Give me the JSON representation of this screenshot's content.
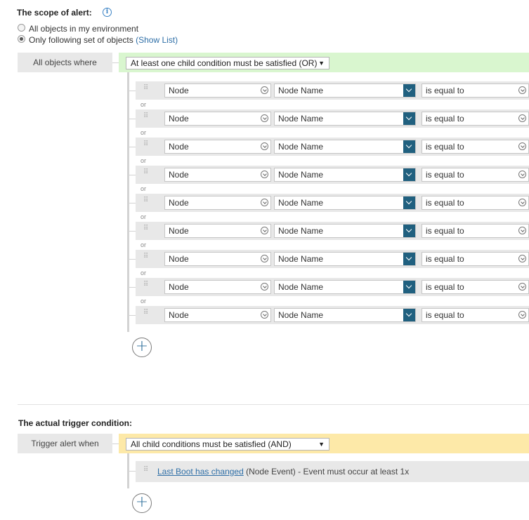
{
  "scope": {
    "title": "The scope of alert:",
    "info_icon": "info-icon",
    "option_all": "All objects in my environment",
    "option_following": "Only following set of objects",
    "show_list": "(Show List)",
    "selected": "following"
  },
  "scope_group": {
    "label": "All objects where",
    "operator": "At least one child condition must be satisfied (OR)",
    "rows": [
      {
        "object": "Node",
        "field": "Node Name",
        "comparison": "is equal to"
      },
      {
        "object": "Node",
        "field": "Node Name",
        "comparison": "is equal to"
      },
      {
        "object": "Node",
        "field": "Node Name",
        "comparison": "is equal to"
      },
      {
        "object": "Node",
        "field": "Node Name",
        "comparison": "is equal to"
      },
      {
        "object": "Node",
        "field": "Node Name",
        "comparison": "is equal to"
      },
      {
        "object": "Node",
        "field": "Node Name",
        "comparison": "is equal to"
      },
      {
        "object": "Node",
        "field": "Node Name",
        "comparison": "is equal to"
      },
      {
        "object": "Node",
        "field": "Node Name",
        "comparison": "is equal to"
      },
      {
        "object": "Node",
        "field": "Node Name",
        "comparison": "is equal to"
      }
    ],
    "separator": "or",
    "add_icon": "plus-circle-icon"
  },
  "trigger": {
    "title": "The actual trigger condition:",
    "label": "Trigger alert when",
    "operator": "All child conditions must be satisfied (AND)",
    "event_link": "Last Boot has changed",
    "event_text": " (Node Event) - Event must occur at least 1x",
    "add_icon": "plus-circle-icon"
  },
  "colors": {
    "scope_bar": "#d9f6cf",
    "trigger_bar": "#fde9a8",
    "field_chevron": "#20607f",
    "link": "#2f6fa7"
  }
}
